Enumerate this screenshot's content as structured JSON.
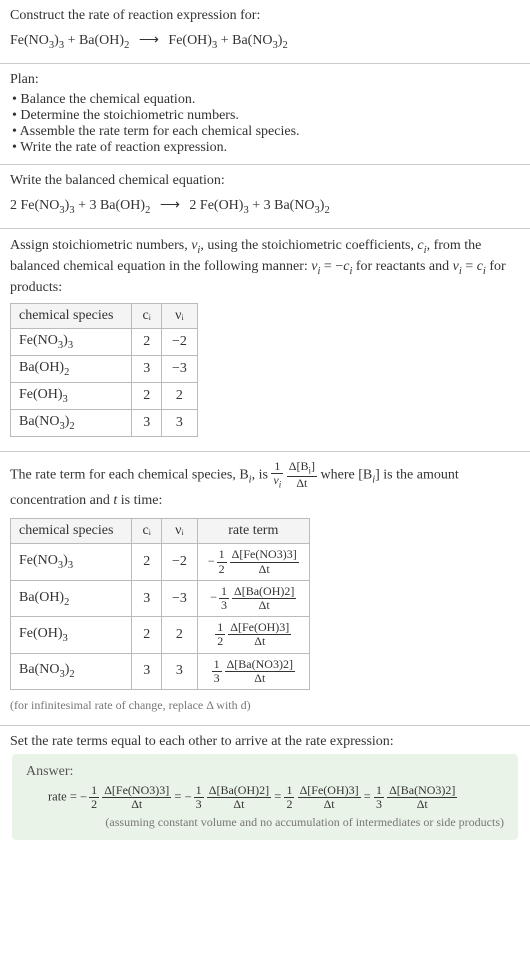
{
  "problem": {
    "heading": "Construct the rate of reaction expression for:",
    "equation_lhs1": "Fe(NO",
    "equation_lhs1_sub1": "3",
    "equation_lhs1_b": ")",
    "equation_lhs1_sub2": "3",
    "plus1": " + ",
    "equation_lhs2": "Ba(OH)",
    "equation_lhs2_sub": "2",
    "arrow": "⟶",
    "equation_rhs1": "Fe(OH)",
    "equation_rhs1_sub": "3",
    "plus2": " + ",
    "equation_rhs2": "Ba(NO",
    "equation_rhs2_sub1": "3",
    "equation_rhs2_b": ")",
    "equation_rhs2_sub2": "2"
  },
  "plan": {
    "heading": "Plan:",
    "items": [
      "Balance the chemical equation.",
      "Determine the stoichiometric numbers.",
      "Assemble the rate term for each chemical species.",
      "Write the rate of reaction expression."
    ]
  },
  "balanced": {
    "heading": "Write the balanced chemical equation:",
    "c1": "2 ",
    "s1a": "Fe(NO",
    "s1s1": "3",
    "s1b": ")",
    "s1s2": "3",
    "plus1": " + ",
    "c2": "3 ",
    "s2a": "Ba(OH)",
    "s2s": "2",
    "arrow": "⟶",
    "c3": "2 ",
    "s3a": "Fe(OH)",
    "s3s": "3",
    "plus2": " + ",
    "c4": "3 ",
    "s4a": "Ba(NO",
    "s4s1": "3",
    "s4b": ")",
    "s4s2": "2"
  },
  "stoich": {
    "intro_a": "Assign stoichiometric numbers, ",
    "intro_nu": "ν",
    "intro_i": "i",
    "intro_b": ", using the stoichiometric coefficients, ",
    "intro_c": "c",
    "intro_d": ", from the balanced chemical equation in the following manner: ",
    "rel1a": "ν",
    "rel1b": " = −",
    "rel1c": "c",
    "rel_for_react": " for reactants and ",
    "rel2a": "ν",
    "rel2b": " = ",
    "rel2c": "c",
    "rel_for_prod": " for products:",
    "headers": {
      "species": "chemical species",
      "ci": "cᵢ",
      "nui": "νᵢ"
    },
    "rows": [
      {
        "name_a": "Fe(NO",
        "s1": "3",
        "name_b": ")",
        "s2": "3",
        "ci": "2",
        "nui": "−2"
      },
      {
        "name_a": "Ba(OH)",
        "s1": "2",
        "name_b": "",
        "s2": "",
        "ci": "3",
        "nui": "−3"
      },
      {
        "name_a": "Fe(OH)",
        "s1": "3",
        "name_b": "",
        "s2": "",
        "ci": "2",
        "nui": "2"
      },
      {
        "name_a": "Ba(NO",
        "s1": "3",
        "name_b": ")",
        "s2": "2",
        "ci": "3",
        "nui": "3"
      }
    ]
  },
  "rateterm": {
    "intro_a": "The rate term for each chemical species, B",
    "intro_b": ", is ",
    "frac1_num": "1",
    "frac1_den_a": "ν",
    "frac1_den_i": "i",
    "frac2_num_a": "Δ[B",
    "frac2_num_i": "i",
    "frac2_num_b": "]",
    "frac2_den": "Δt",
    "intro_c": " where [B",
    "intro_d": "] is the amount concentration and ",
    "intro_t": "t",
    "intro_e": " is time:",
    "headers": {
      "species": "chemical species",
      "ci": "cᵢ",
      "nui": "νᵢ",
      "rate": "rate term"
    },
    "rows": [
      {
        "name_a": "Fe(NO",
        "s1": "3",
        "name_b": ")",
        "s2": "3",
        "ci": "2",
        "nui": "−2",
        "sign": "−",
        "f1n": "1",
        "f1d": "2",
        "f2n": "Δ[Fe(NO3)3]",
        "f2d": "Δt"
      },
      {
        "name_a": "Ba(OH)",
        "s1": "2",
        "name_b": "",
        "s2": "",
        "ci": "3",
        "nui": "−3",
        "sign": "−",
        "f1n": "1",
        "f1d": "3",
        "f2n": "Δ[Ba(OH)2]",
        "f2d": "Δt"
      },
      {
        "name_a": "Fe(OH)",
        "s1": "3",
        "name_b": "",
        "s2": "",
        "ci": "2",
        "nui": "2",
        "sign": "",
        "f1n": "1",
        "f1d": "2",
        "f2n": "Δ[Fe(OH)3]",
        "f2d": "Δt"
      },
      {
        "name_a": "Ba(NO",
        "s1": "3",
        "name_b": ")",
        "s2": "2",
        "ci": "3",
        "nui": "3",
        "sign": "",
        "f1n": "1",
        "f1d": "3",
        "f2n": "Δ[Ba(NO3)2]",
        "f2d": "Δt"
      }
    ],
    "note": "(for infinitesimal rate of change, replace Δ with d)"
  },
  "final": {
    "heading": "Set the rate terms equal to each other to arrive at the rate expression:",
    "answer_label": "Answer:",
    "rate_word": "rate = ",
    "terms": [
      {
        "sign": "−",
        "f1n": "1",
        "f1d": "2",
        "f2n": "Δ[Fe(NO3)3]",
        "f2d": "Δt"
      },
      {
        "sign": "−",
        "f1n": "1",
        "f1d": "3",
        "f2n": "Δ[Ba(OH)2]",
        "f2d": "Δt"
      },
      {
        "sign": "",
        "f1n": "1",
        "f1d": "2",
        "f2n": "Δ[Fe(OH)3]",
        "f2d": "Δt"
      },
      {
        "sign": "",
        "f1n": "1",
        "f1d": "3",
        "f2n": "Δ[Ba(NO3)2]",
        "f2d": "Δt"
      }
    ],
    "eq": " = ",
    "answer_note": "(assuming constant volume and no accumulation of intermediates or side products)"
  }
}
